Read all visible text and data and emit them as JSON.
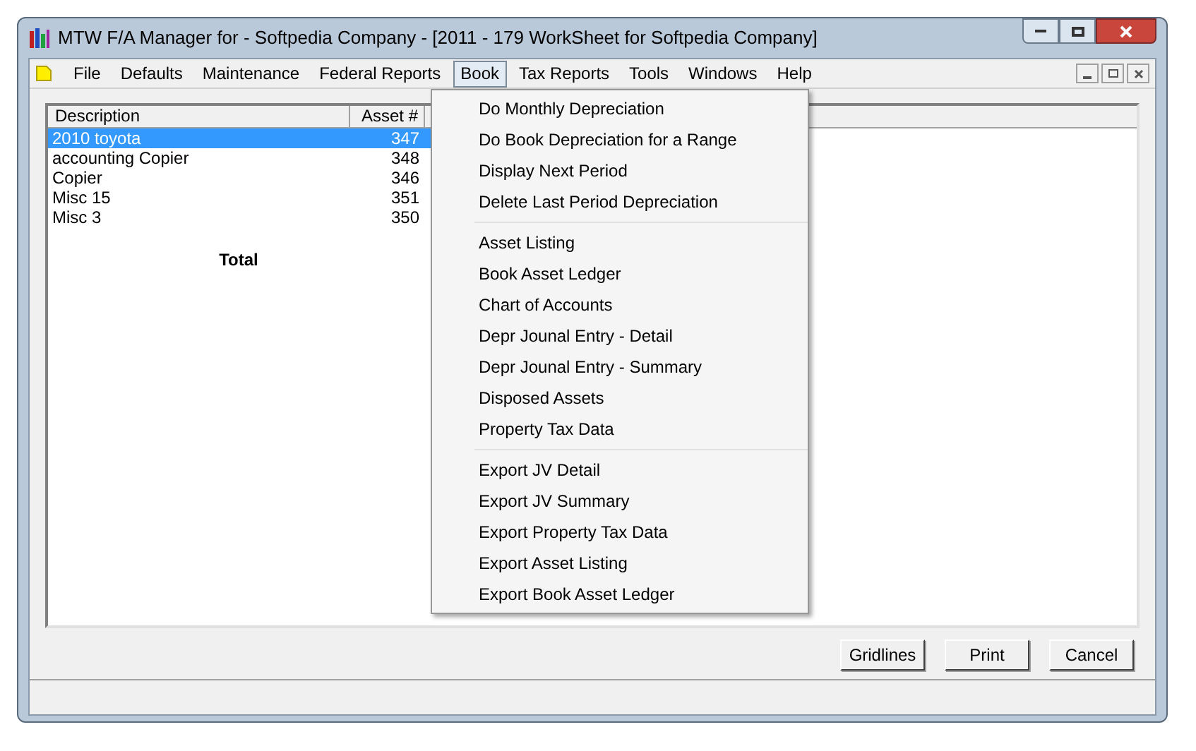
{
  "window": {
    "title": "MTW F/A Manager for - Softpedia Company - [2011 - 179 WorkSheet for Softpedia Company]"
  },
  "menu_bar": [
    {
      "label": "File",
      "selected": false
    },
    {
      "label": "Defaults",
      "selected": false
    },
    {
      "label": "Maintenance",
      "selected": false
    },
    {
      "label": "Federal Reports",
      "selected": false
    },
    {
      "label": "Book",
      "selected": true
    },
    {
      "label": "Tax Reports",
      "selected": false
    },
    {
      "label": "Tools",
      "selected": false
    },
    {
      "label": "Windows",
      "selected": false
    },
    {
      "label": "Help",
      "selected": false
    }
  ],
  "table": {
    "columns": [
      "Description",
      "Asset #"
    ],
    "rows": [
      {
        "description": "2010 toyota",
        "asset": "347",
        "selected": true
      },
      {
        "description": "accounting Copier",
        "asset": "348",
        "selected": false
      },
      {
        "description": "Copier",
        "asset": "346",
        "selected": false
      },
      {
        "description": "Misc 15",
        "asset": "351",
        "selected": false
      },
      {
        "description": "Misc 3",
        "asset": "350",
        "selected": false
      }
    ],
    "total_label": "Total"
  },
  "book_menu": [
    [
      "Do Monthly Depreciation",
      "Do Book Depreciation for a Range",
      "Display Next Period",
      "Delete Last Period Depreciation"
    ],
    [
      "Asset Listing",
      "Book Asset Ledger",
      "Chart of Accounts",
      "Depr Jounal Entry - Detail",
      "Depr Jounal Entry - Summary",
      "Disposed Assets",
      "Property Tax Data"
    ],
    [
      "Export JV Detail",
      "Export JV Summary",
      "Export Property Tax Data",
      "Export Asset Listing",
      "Export Book Asset Ledger"
    ]
  ],
  "buttons": [
    "Gridlines",
    "Print",
    "Cancel"
  ]
}
